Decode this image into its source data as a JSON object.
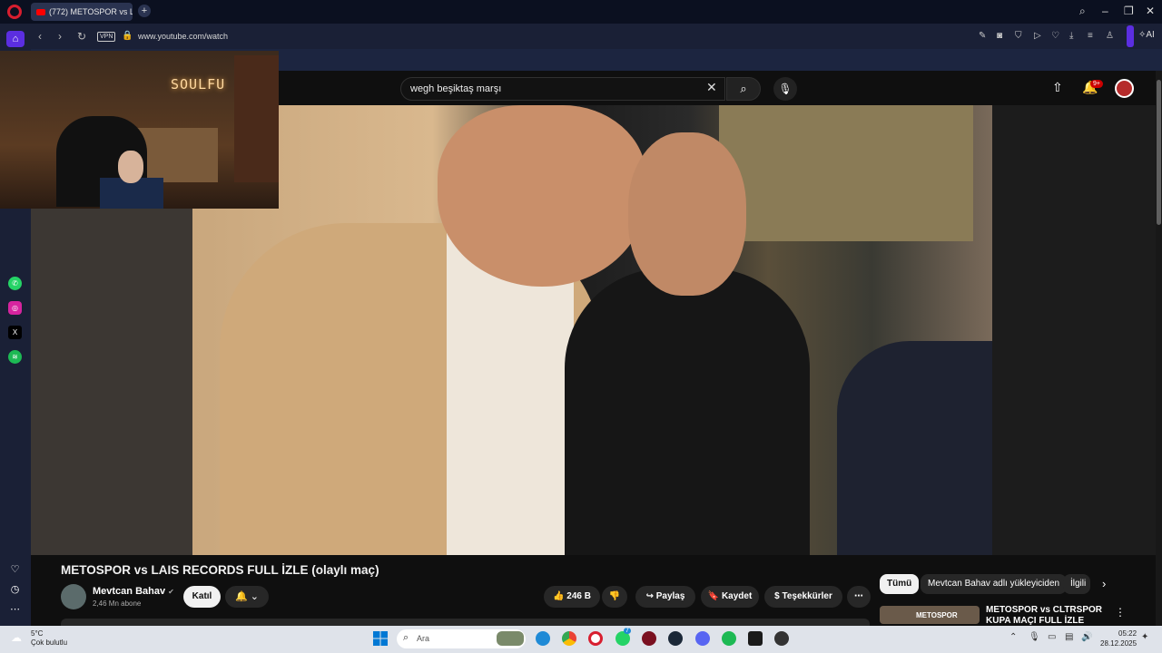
{
  "browser": {
    "tab_title": "(772) METOSPOR vs L",
    "tab_close": "×",
    "new_tab": "+",
    "url": "www.youtube.com/watch",
    "vpn_label": "VPN",
    "ai_label": "AI"
  },
  "youtube": {
    "search_value": "wegh beşiktaş marşı",
    "notification_badge": "9+",
    "video_title": "METOSPOR vs LAIS RECORDS FULL İZLE (olaylı maç)",
    "channel_name": "Mevtcan Bahav",
    "subscribers": "2,46 Mn abone",
    "join_label": "Katıl",
    "like_count": "246 B",
    "share_label": "Paylaş",
    "save_label": "Kaydet",
    "thanks_label": "Teşekkürler",
    "chips": [
      "Tümü",
      "Mevtcan Bahav adlı yükleyiciden",
      "İlgili"
    ],
    "recommended_title": "METOSPOR vs CLTRSPOR KUPA MAÇI FULL İZLE",
    "recommended_thumb_text": "METOSPOR"
  },
  "webcam": {
    "neon_text": "SOULFU"
  },
  "taskbar": {
    "weather_temp": "5°C",
    "weather_desc": "Çok bulutlu",
    "search_placeholder": "Ara",
    "time": "05:22",
    "date": "28.12.2025",
    "badge_count": "7"
  }
}
